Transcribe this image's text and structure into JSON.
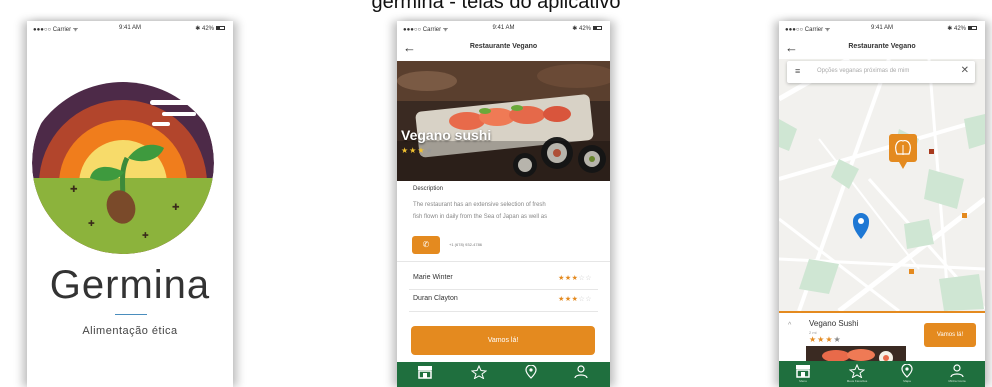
{
  "caption": {
    "text": "germina - telas do aplicativo"
  },
  "status_bar": {
    "carrier": "●●●○○ Carrier ᯤ",
    "time": "9:41 AM",
    "battery": "✱ 42%"
  },
  "splash": {
    "brand": "Germina",
    "tagline": "Alimentação ética"
  },
  "detail": {
    "back_icon": "←",
    "title": "Restaurante Vegano",
    "restaurant_name": "Vegano sushi",
    "stars_on": "★★★",
    "stars_off": "★",
    "description_label": "Description",
    "description_line1": "The restaurant has an extensive selection of fresh",
    "description_line2": "fish flown in daily from the Sea of Japan as well as",
    "call_icon": "✆",
    "phone": "+1 (678) 932-4786",
    "reviews": [
      {
        "name": "Marie Winter",
        "stars_on": "★★★",
        "stars_off": "☆☆"
      },
      {
        "name": "Duran Clayton",
        "stars_on": "★★★",
        "stars_off": "☆☆"
      }
    ],
    "cta_label": "Vamos lá!"
  },
  "map_screen": {
    "back_icon": "←",
    "title": "Restaurante Vegano",
    "menu_icon": "≡",
    "search_placeholder": "Opções veganas próximas de mim",
    "clear_icon": "✕",
    "card": {
      "chevron": "^",
      "name": "Vegano Sushi",
      "distance": "2 mi",
      "stars_on": "★★★",
      "stars_off": "★",
      "cta_label": "Vamos lá!"
    },
    "tabs": [
      "Menu",
      "Meus Favoritos",
      "Mapa",
      "Minha Conta"
    ]
  },
  "colors": {
    "accent": "#e48a1f",
    "tabbar": "#1f6f3e",
    "map_bg": "#f2f1ee",
    "map_park": "#cfe6d3",
    "pin": "#1e78d4"
  },
  "icons": [
    "store-icon",
    "star-outline-icon",
    "location-pin-icon",
    "user-icon",
    "leaf-icon"
  ]
}
